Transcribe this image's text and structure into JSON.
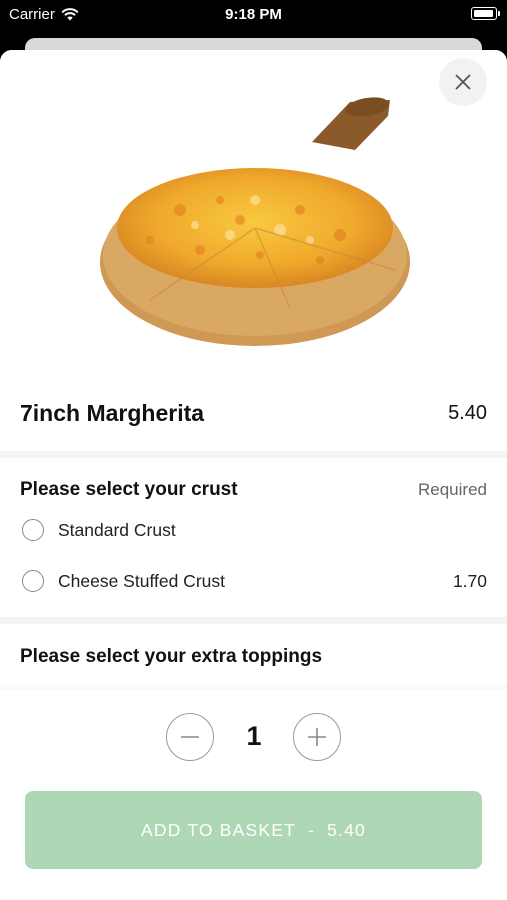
{
  "status_bar": {
    "carrier": "Carrier",
    "time": "9:18 PM"
  },
  "product": {
    "name": "7inch Margherita",
    "price": "5.40",
    "image": "margherita-pizza-on-wooden-board"
  },
  "crust": {
    "title": "Please select your crust",
    "required_label": "Required",
    "options": [
      {
        "label": "Standard Crust",
        "price": "",
        "selected": false
      },
      {
        "label": "Cheese Stuffed Crust",
        "price": "1.70",
        "selected": false
      }
    ]
  },
  "toppings": {
    "title": "Please select your extra toppings"
  },
  "quantity": {
    "value": "1"
  },
  "basket_button": {
    "label": "ADD TO BASKET",
    "separator": "-",
    "total": "5.40",
    "color": "#aed7b6"
  },
  "icons": {
    "close": "close-icon",
    "minus": "minus-icon",
    "plus": "plus-icon",
    "wifi": "wifi-icon",
    "battery": "battery-icon"
  }
}
